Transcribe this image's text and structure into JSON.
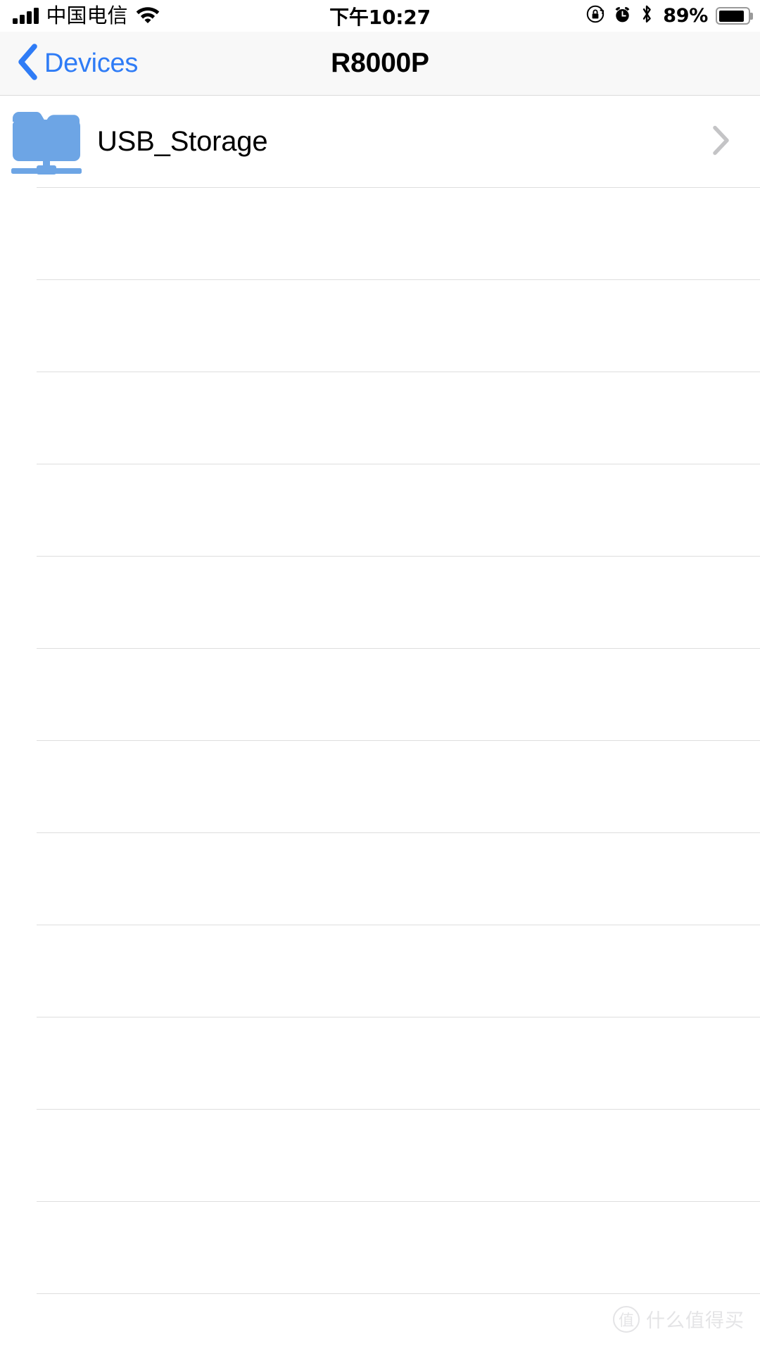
{
  "status_bar": {
    "carrier": "中国电信",
    "signal_icon": "signal-bars-icon",
    "wifi_icon": "wifi-icon",
    "time": "下午10:27",
    "rotation_lock_icon": "rotation-lock-icon",
    "alarm_icon": "alarm-clock-icon",
    "bluetooth_icon": "bluetooth-icon",
    "battery_percent": "89%",
    "battery_level": 89,
    "battery_icon": "battery-icon"
  },
  "nav_bar": {
    "back_label": "Devices",
    "back_icon": "chevron-left-icon",
    "title": "R8000P",
    "accent_color": "#2f7cf6",
    "background_color": "#f8f8f8"
  },
  "list": {
    "rows": [
      {
        "label": "USB_Storage",
        "icon": "network-folder-icon",
        "icon_color": "#6da5e5",
        "accessory": "chevron-right-icon"
      }
    ],
    "empty_row_count": 12,
    "separator_color": "#dedede"
  },
  "watermark": {
    "badge": "值",
    "text": "什么值得买",
    "color": "#e4e4e6"
  }
}
